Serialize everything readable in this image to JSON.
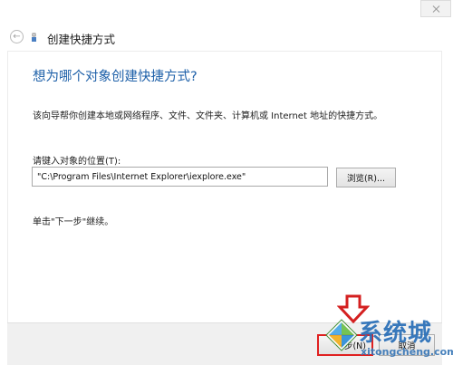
{
  "window": {
    "title": "创建快捷方式"
  },
  "wizard": {
    "heading": "想为哪个对象创建快捷方式?",
    "description": "该向导帮你创建本地或网络程序、文件、文件夹、计算机或 Internet 地址的快捷方式。",
    "location_label": "请键入对象的位置(T):",
    "location_value": "\"C:\\Program Files\\Internet Explorer\\iexplore.exe\"",
    "browse_label": "浏览(R)...",
    "hint": "单击\"下一步\"继续。"
  },
  "footer": {
    "next_label": "一步(N)",
    "cancel_label": "取消"
  },
  "watermark": {
    "brand": "系统城",
    "url": "xitongcheng.com"
  },
  "icons": {
    "back": "back-arrow-icon",
    "wizard": "shortcut-wizard-icon",
    "close": "close-icon",
    "annotation": "down-arrow-icon"
  },
  "colors": {
    "heading": "#1c5fa8",
    "highlight": "#e02020",
    "footer_bg": "#f0f0f0"
  }
}
